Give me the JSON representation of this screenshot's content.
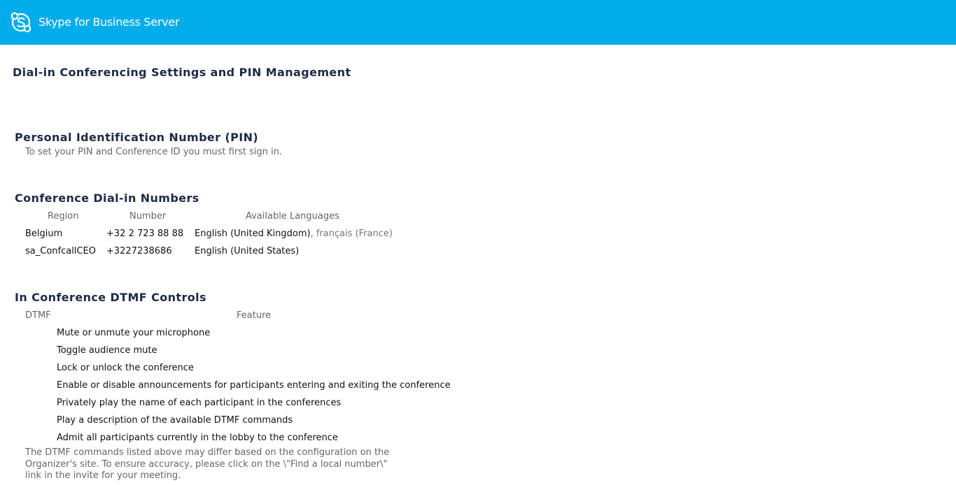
{
  "header": {
    "brand": "Skype for Business Server",
    "accent_color": "#00adea",
    "logo_icon": "skype-logo-icon"
  },
  "page_title": "Dial-in Conferencing Settings and PIN Management",
  "pin_section": {
    "title": "Personal Identification Number (PIN)",
    "message": "To set your PIN and Conference ID you must first sign in."
  },
  "dialin_section": {
    "title": "Conference Dial-in Numbers",
    "columns": {
      "region": "Region",
      "number": "Number",
      "languages": "Available Languages"
    },
    "rows": [
      {
        "region": "Belgium",
        "number": "+32 2 723 88 88",
        "primary_language": "English (United Kingdom)",
        "other_languages": ", français (France)"
      },
      {
        "region": "sa_ConfcallCEO",
        "number": "+3227238686",
        "primary_language": "English (United States)",
        "other_languages": ""
      }
    ]
  },
  "dtmf_section": {
    "title": "In Conference DTMF Controls",
    "columns": {
      "dtmf": "DTMF",
      "feature": "Feature"
    },
    "features": [
      "Mute or unmute your microphone",
      "Toggle audience mute",
      "Lock or unlock the conference",
      "Enable or disable announcements for participants entering and exiting the conference",
      "Privately play the name of each participant in the conferences",
      "Play a description of the available DTMF commands",
      "Admit all participants currently in the lobby to the conference"
    ],
    "footnote": "The DTMF commands listed above may differ based on the configuration on the Organizer's site. To ensure accuracy, please click on the \\\"Find a local number\\\" link in the invite for your meeting."
  }
}
